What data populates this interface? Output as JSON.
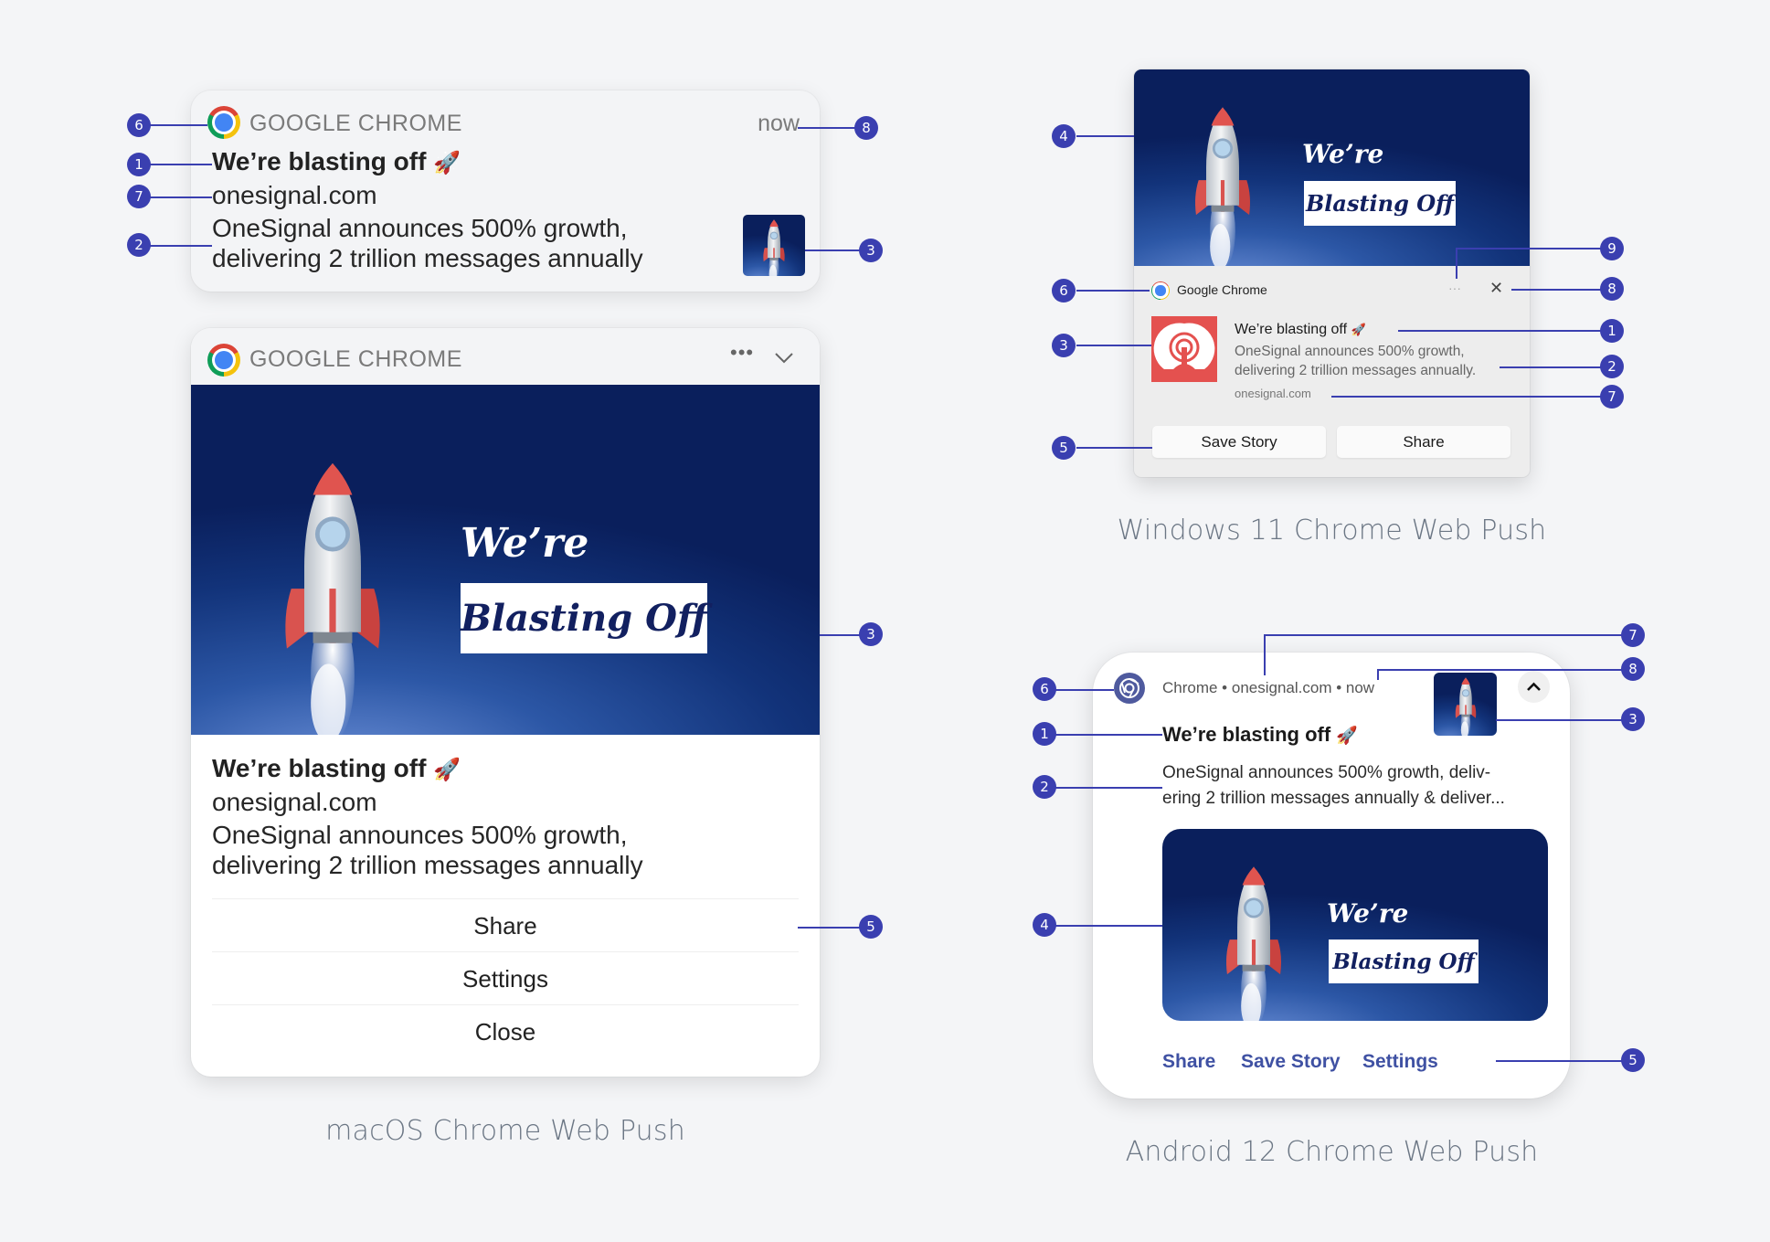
{
  "accent_color": "#3a3fb0",
  "notification": {
    "title": "We’re blasting off",
    "title_emoji": "🚀",
    "origin": "onesignal.com",
    "body_line1": "OneSignal announces 500% growth,",
    "body_line2": "delivering 2 trillion messages annually",
    "hero_text_line1": "We’re",
    "hero_text_line2": "Blasting Off"
  },
  "macos": {
    "caption": "macOS Chrome Web Push",
    "app_name": "GOOGLE CHROME",
    "timestamp": "now",
    "more_icon": "ellipsis-icon",
    "collapse_icon": "chevron-down-icon",
    "actions": [
      "Share",
      "Settings",
      "Close"
    ],
    "callouts_compact": [
      "6",
      "1",
      "7",
      "2",
      "8",
      "3"
    ],
    "callouts_expanded": [
      "3",
      "5"
    ]
  },
  "windows": {
    "caption": "Windows 11 Chrome Web Push",
    "app_name": "Google Chrome",
    "body_line1": "OneSignal announces 500% growth,",
    "body_line2": "delivering 2 trillion messages annually.",
    "more_icon": "ellipsis-icon",
    "close_icon": "close-icon",
    "more_label": "···",
    "close_label": "✕",
    "actions": [
      "Save Story",
      "Share"
    ],
    "callouts": [
      "4",
      "9",
      "6",
      "8",
      "3",
      "1",
      "2",
      "7",
      "5"
    ]
  },
  "android": {
    "caption": "Android 12 Chrome Web Push",
    "header": "Chrome • onesignal.com • now",
    "body_line1": "OneSignal announces 500% growth, deliv-",
    "body_line2": "ering 2 trillion messages annually & deliver...",
    "expand_icon": "chevron-up-icon",
    "actions": [
      "Share",
      "Save Story",
      "Settings"
    ],
    "callouts": [
      "7",
      "8",
      "6",
      "3",
      "1",
      "2",
      "4",
      "5"
    ]
  }
}
